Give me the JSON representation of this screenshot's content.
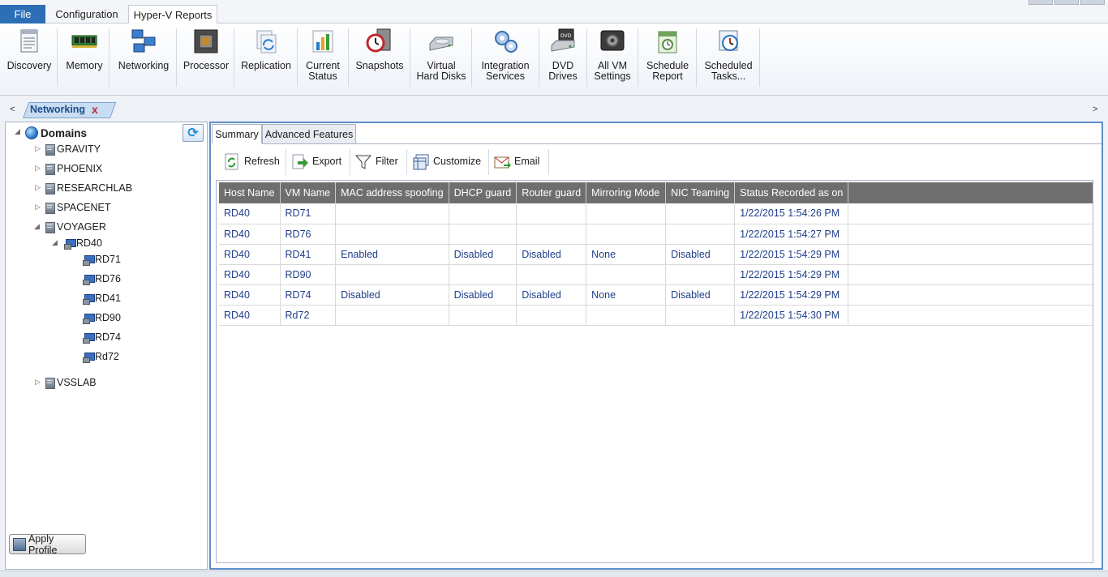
{
  "menu": {
    "file_label": "File",
    "tabs": [
      "Configuration",
      "Hyper-V Reports"
    ]
  },
  "ribbon": {
    "buttons": [
      {
        "line1": "Discovery",
        "line2": "",
        "icon": "discovery-icon"
      },
      {
        "line1": "Memory",
        "line2": "",
        "icon": "memory-icon"
      },
      {
        "line1": "Networking",
        "line2": "",
        "icon": "networking-icon"
      },
      {
        "line1": "Processor",
        "line2": "",
        "icon": "processor-icon"
      },
      {
        "line1": "Replication",
        "line2": "",
        "icon": "replication-icon"
      },
      {
        "line1": "Current",
        "line2": "Status",
        "icon": "status-chart-icon"
      },
      {
        "line1": "Snapshots",
        "line2": "",
        "icon": "snapshot-clock-icon"
      },
      {
        "line1": "Virtual",
        "line2": "Hard Disks",
        "icon": "hard-disk-icon"
      },
      {
        "line1": "Integration",
        "line2": "Services",
        "icon": "gears-icon"
      },
      {
        "line1": "DVD",
        "line2": "Drives",
        "icon": "dvd-drive-icon"
      },
      {
        "line1": "All VM",
        "line2": "Settings",
        "icon": "vm-settings-icon"
      },
      {
        "line1": "Schedule",
        "line2": "Report",
        "icon": "schedule-report-icon"
      },
      {
        "line1": "Scheduled",
        "line2": "Tasks...",
        "icon": "scheduled-tasks-icon"
      }
    ]
  },
  "doc_tabs": {
    "left_arrow": "<",
    "right_arrow": ">",
    "active_label": "Networking",
    "close_glyph": "x"
  },
  "tree": {
    "root_label": "Domains",
    "domains": [
      "GRAVITY",
      "PHOENIX",
      "RESEARCHLAB",
      "SPACENET",
      "VOYAGER",
      "VSSLAB"
    ],
    "host_label": "RD40",
    "vms": [
      "RD71",
      "RD76",
      "RD41",
      "RD90",
      "RD74",
      "Rd72"
    ],
    "apply_profile_label": "Apply Profile"
  },
  "content": {
    "tabs": [
      "Summary",
      "Advanced Features"
    ],
    "toolbar": {
      "refresh": "Refresh",
      "export": "Export",
      "filter": "Filter",
      "customize": "Customize",
      "email": "Email"
    },
    "columns": [
      "Host Name",
      "VM Name",
      "MAC address spoofing",
      "DHCP guard",
      "Router guard",
      "Mirroring Mode",
      "NIC Teaming",
      "Status Recorded as on"
    ],
    "rows": [
      [
        "RD40",
        "RD71",
        "",
        "",
        "",
        "",
        "",
        "1/22/2015 1:54:26 PM"
      ],
      [
        "RD40",
        "RD76",
        "",
        "",
        "",
        "",
        "",
        "1/22/2015 1:54:27 PM"
      ],
      [
        "RD40",
        "RD41",
        "Enabled",
        "Disabled",
        "Disabled",
        "None",
        "Disabled",
        "1/22/2015 1:54:29 PM"
      ],
      [
        "RD40",
        "RD90",
        "",
        "",
        "",
        "",
        "",
        "1/22/2015 1:54:29 PM"
      ],
      [
        "RD40",
        "RD74",
        "Disabled",
        "Disabled",
        "Disabled",
        "None",
        "Disabled",
        "1/22/2015 1:54:29 PM"
      ],
      [
        "RD40",
        "Rd72",
        "",
        "",
        "",
        "",
        "",
        "1/22/2015 1:54:30 PM"
      ]
    ]
  },
  "colors": {
    "accent": "#2c6fb6",
    "grid_header": "#6e6e6e",
    "cell_text": "#1f3e8a",
    "panel_border": "#5f8fc7"
  }
}
